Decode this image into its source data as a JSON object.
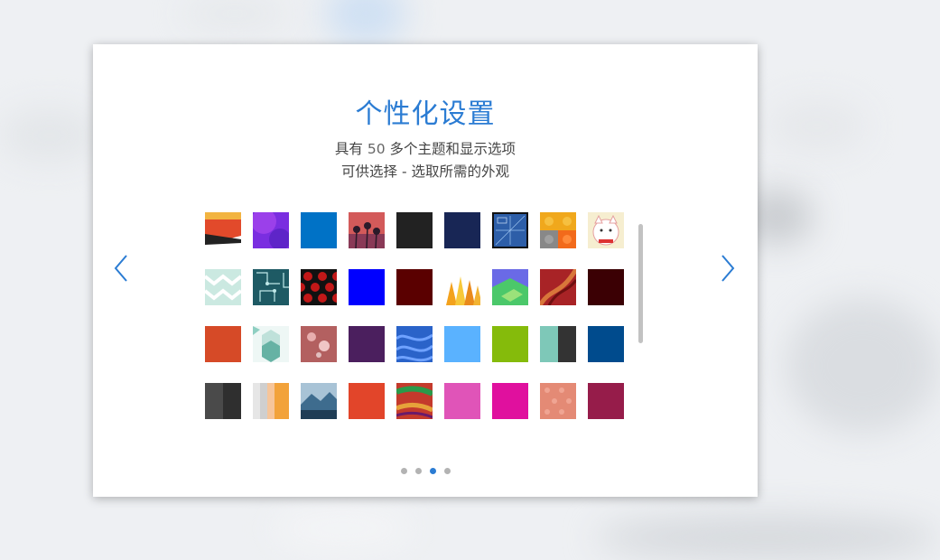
{
  "dialog": {
    "title": "个性化设置",
    "subtitle_part1": "具有",
    "subtitle_num": "50",
    "subtitle_part2": "多个主题和显示选项",
    "subtitle_line2": "可供选择 - 选取所需的外观"
  },
  "navigation": {
    "prev_icon": "chevron-left-icon",
    "next_icon": "chevron-right-icon",
    "page_count": 4,
    "active_page": 3
  },
  "colors": {
    "accent": "#2b7cd3",
    "dot_inactive": "#b3b3b3",
    "scrollbar": "#c2c2c2"
  },
  "themes": [
    {
      "name": "theme-red-mountain",
      "color": "#e24a2b"
    },
    {
      "name": "theme-purple-glow",
      "color": "#7a2ee0"
    },
    {
      "name": "theme-blue",
      "color": "#0072c6"
    },
    {
      "name": "theme-palm-sunset",
      "color": "#d35a5a"
    },
    {
      "name": "theme-dark-gray",
      "color": "#222222"
    },
    {
      "name": "theme-navy",
      "color": "#182655"
    },
    {
      "name": "theme-blueprint",
      "color": "#2d5ea8"
    },
    {
      "name": "theme-lego",
      "color": "#f0a81c"
    },
    {
      "name": "theme-lucky-cat",
      "color": "#f6eed0"
    },
    {
      "name": "theme-mint-chevron",
      "color": "#cbe9e1"
    },
    {
      "name": "theme-circuit",
      "color": "#1e5a64"
    },
    {
      "name": "theme-red-pattern",
      "color": "#c21818"
    },
    {
      "name": "theme-bright-blue",
      "color": "#0000ff"
    },
    {
      "name": "theme-maroon",
      "color": "#5a0000"
    },
    {
      "name": "theme-pencils",
      "color": "#f3a21d"
    },
    {
      "name": "theme-green-blocks",
      "color": "#4bc86a"
    },
    {
      "name": "theme-red-fabric",
      "color": "#a82326"
    },
    {
      "name": "theme-dark-maroon",
      "color": "#3b0004"
    },
    {
      "name": "theme-orange-red",
      "color": "#d64a27"
    },
    {
      "name": "theme-teal-hexagon",
      "color": "#bfe1da"
    },
    {
      "name": "theme-bokeh",
      "color": "#b36060"
    },
    {
      "name": "theme-deep-purple",
      "color": "#4b1f5e"
    },
    {
      "name": "theme-blue-waves",
      "color": "#2a63c9"
    },
    {
      "name": "theme-sky-blue",
      "color": "#5ab2ff"
    },
    {
      "name": "theme-lime-green",
      "color": "#85bb0b"
    },
    {
      "name": "theme-teal-dark-split",
      "color": "#7ec8b8"
    },
    {
      "name": "theme-ocean-blue",
      "color": "#004b8d"
    },
    {
      "name": "theme-gray-split",
      "color": "#4a4a4a"
    },
    {
      "name": "theme-stripes-orange",
      "color": "#f2a23a"
    },
    {
      "name": "theme-mountain-lake",
      "color": "#3e6c8e"
    },
    {
      "name": "theme-red-orange",
      "color": "#e2452a"
    },
    {
      "name": "theme-paint-strokes",
      "color": "#c43a2c"
    },
    {
      "name": "theme-pink",
      "color": "#e054b8"
    },
    {
      "name": "theme-magenta",
      "color": "#e0109e"
    },
    {
      "name": "theme-salmon-dots",
      "color": "#e48a75"
    },
    {
      "name": "theme-crimson",
      "color": "#961c4a"
    }
  ]
}
